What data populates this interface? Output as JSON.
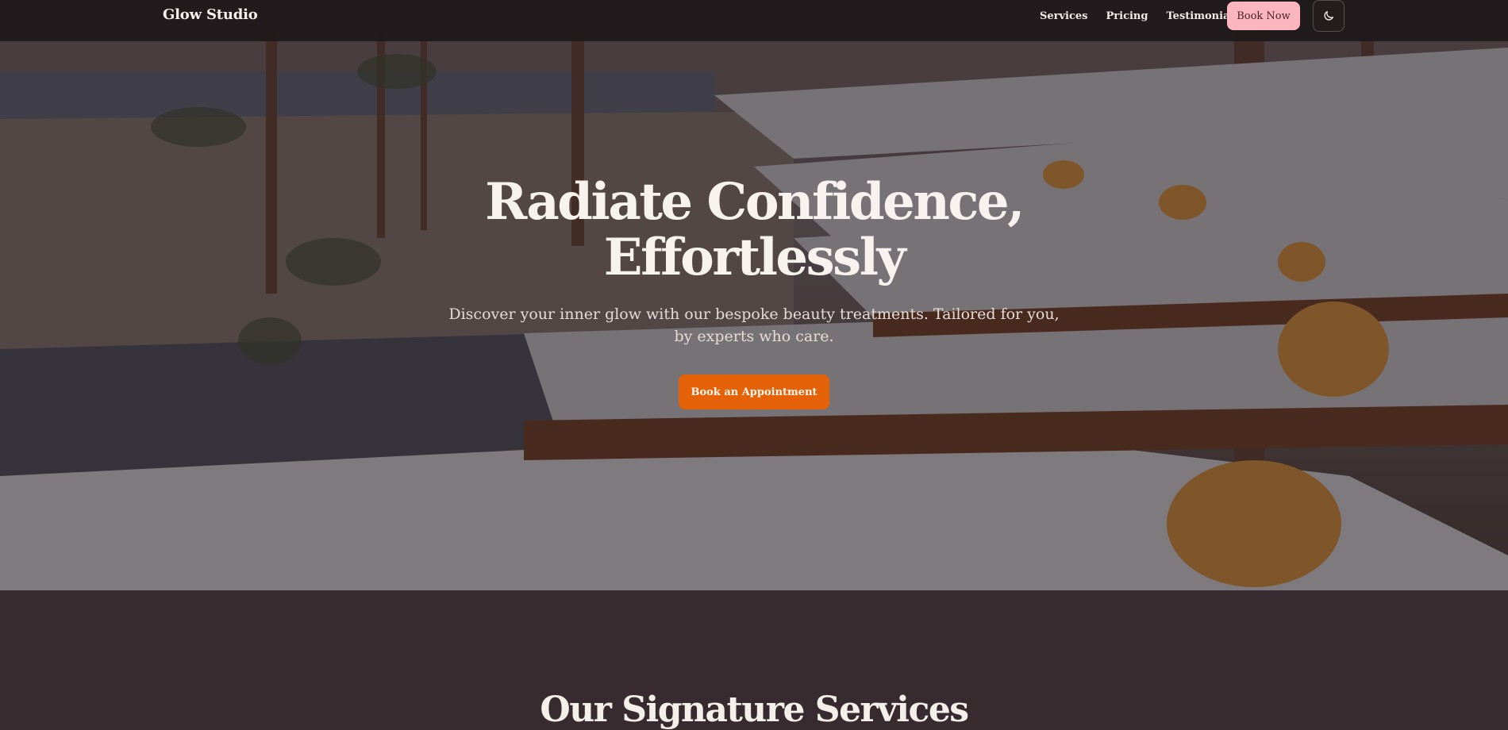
{
  "header": {
    "brand": "Glow Studio",
    "nav": [
      "Services",
      "Pricing",
      "Testimonials"
    ],
    "book_now_label": "Book Now",
    "theme_toggle_icon": "moon-icon"
  },
  "hero": {
    "title_line1": "Radiate Confidence,",
    "title_line2": "Effortlessly",
    "subtitle": "Discover your inner glow with our bespoke beauty treatments. Tailored for you, by experts who care.",
    "cta_label": "Book an Appointment",
    "background": "beach-loungers-photo"
  },
  "services": {
    "title": "Our Signature Services"
  },
  "colors": {
    "header_bg": "#201819",
    "book_now_bg": "#fbb6c0",
    "cta_bg": "#e66208",
    "section_bg": "#382b30"
  }
}
